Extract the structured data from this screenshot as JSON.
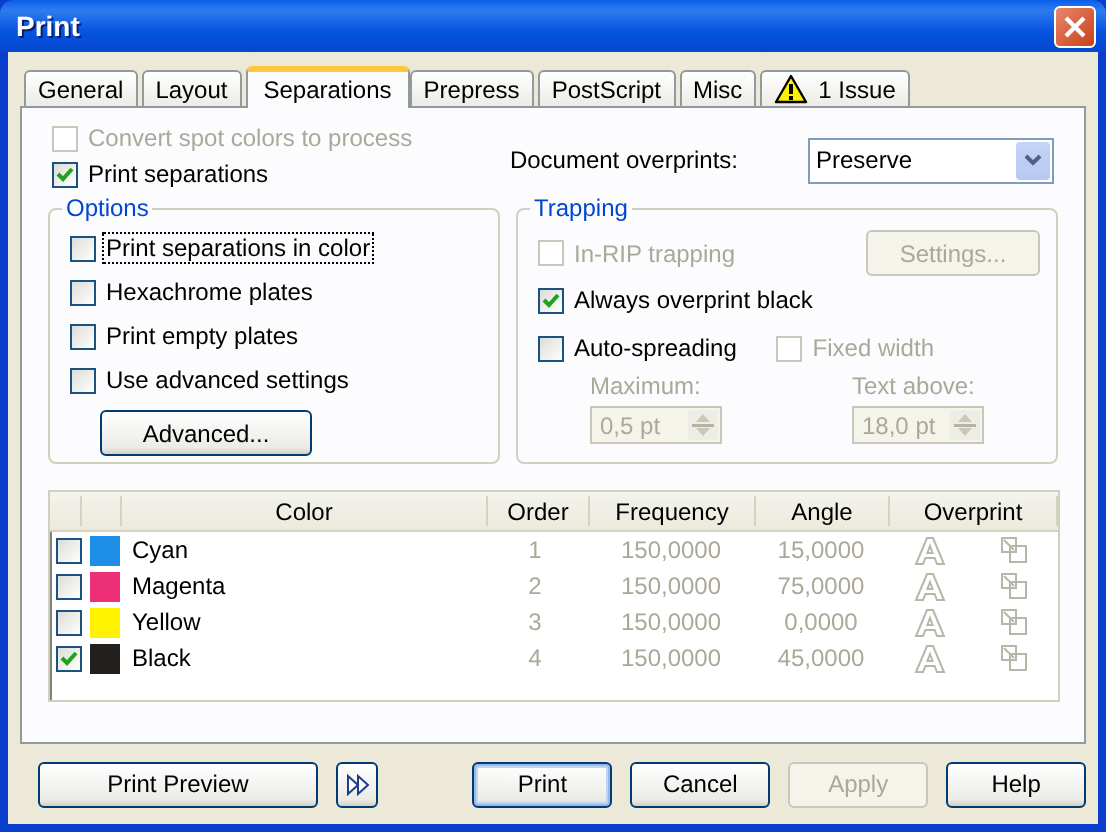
{
  "window": {
    "title": "Print"
  },
  "tabs": [
    {
      "label": "General",
      "selected": false,
      "kind": "plain"
    },
    {
      "label": "Layout",
      "selected": false,
      "kind": "plain"
    },
    {
      "label": "Separations",
      "selected": true,
      "kind": "plain"
    },
    {
      "label": "Prepress",
      "selected": false,
      "kind": "plain"
    },
    {
      "label": "PostScript",
      "selected": false,
      "kind": "plain"
    },
    {
      "label": "Misc",
      "selected": false,
      "kind": "plain"
    },
    {
      "label": "1 Issue",
      "selected": false,
      "kind": "warning"
    }
  ],
  "convert_spot_colors": {
    "label": "Convert spot colors to process",
    "checked": false,
    "disabled": true
  },
  "print_separations": {
    "label": "Print separations",
    "checked": true,
    "disabled": false
  },
  "document_overprints": {
    "label": "Document overprints:",
    "value": "Preserve"
  },
  "options": {
    "title": "Options",
    "items": [
      {
        "label": "Print separations in color",
        "checked": false,
        "disabled": false,
        "focused": true
      },
      {
        "label": "Hexachrome plates",
        "checked": false,
        "disabled": false,
        "focused": false
      },
      {
        "label": "Print empty plates",
        "checked": false,
        "disabled": false,
        "focused": false
      },
      {
        "label": "Use advanced settings",
        "checked": false,
        "disabled": false,
        "focused": false
      }
    ],
    "button": "Advanced..."
  },
  "trapping": {
    "title": "Trapping",
    "in_rip_trapping": {
      "label": "In-RIP trapping",
      "checked": false,
      "disabled": true
    },
    "settings_button": {
      "label": "Settings...",
      "disabled": true
    },
    "always_overprint_black": {
      "label": "Always overprint black",
      "checked": true,
      "disabled": false
    },
    "auto_spreading": {
      "label": "Auto-spreading",
      "checked": false,
      "disabled": false
    },
    "fixed_width": {
      "label": "Fixed width",
      "checked": false,
      "disabled": true
    },
    "maximum": {
      "label": "Maximum:",
      "value": "0,5 pt",
      "disabled": true
    },
    "text_above": {
      "label": "Text above:",
      "value": "18,0 pt",
      "disabled": true
    }
  },
  "table": {
    "columns": [
      "Color",
      "Order",
      "Frequency",
      "Angle",
      "Overprint"
    ],
    "rows": [
      {
        "checked": false,
        "color": "#1e8ee6",
        "name": "Cyan",
        "order": "1",
        "frequency": "150,0000",
        "angle": "15,0000"
      },
      {
        "checked": false,
        "color": "#ec2f76",
        "name": "Magenta",
        "order": "2",
        "frequency": "150,0000",
        "angle": "75,0000"
      },
      {
        "checked": false,
        "color": "#fff200",
        "name": "Yellow",
        "order": "3",
        "frequency": "150,0000",
        "angle": "0,0000"
      },
      {
        "checked": true,
        "color": "#231f1c",
        "name": "Black",
        "order": "4",
        "frequency": "150,0000",
        "angle": "45,0000"
      }
    ]
  },
  "buttons": [
    {
      "kind": "text",
      "label": "Print Preview",
      "disabled": false,
      "default": false
    },
    {
      "kind": "forward",
      "disabled": false,
      "default": false
    },
    {
      "kind": "text",
      "label": "Print",
      "disabled": false,
      "default": true
    },
    {
      "kind": "text",
      "label": "Cancel",
      "disabled": false,
      "default": false
    },
    {
      "kind": "text",
      "label": "Apply",
      "disabled": true,
      "default": false
    },
    {
      "kind": "text",
      "label": "Help",
      "disabled": false,
      "default": false
    }
  ]
}
